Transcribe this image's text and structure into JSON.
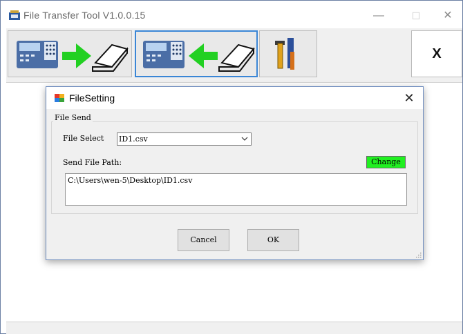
{
  "window": {
    "title": "File Transfer Tool  V1.0.0.15",
    "controls": {
      "minimize": "—",
      "maximize": "☐",
      "close": "✕"
    }
  },
  "toolbar": {
    "send_button_icon": "scale-arrow-right-laptop-icon",
    "receive_button_icon": "scale-arrow-left-laptop-icon",
    "settings_button_icon": "tools-icon",
    "exit_label": "X"
  },
  "dialog": {
    "title": "FileSetting",
    "close_glyph": "✕",
    "group_label": "File Send",
    "file_select_label": "File Select",
    "file_select_value": "ID1.csv",
    "send_path_label": "Send File Path:",
    "change_label": "Change",
    "path_value": "C:\\Users\\wen-5\\Desktop\\ID1.csv",
    "cancel_label": "Cancel",
    "ok_label": "OK"
  },
  "colors": {
    "change_button": "#21f021",
    "active_border": "#3a86d6",
    "arrow_green": "#22d022"
  }
}
